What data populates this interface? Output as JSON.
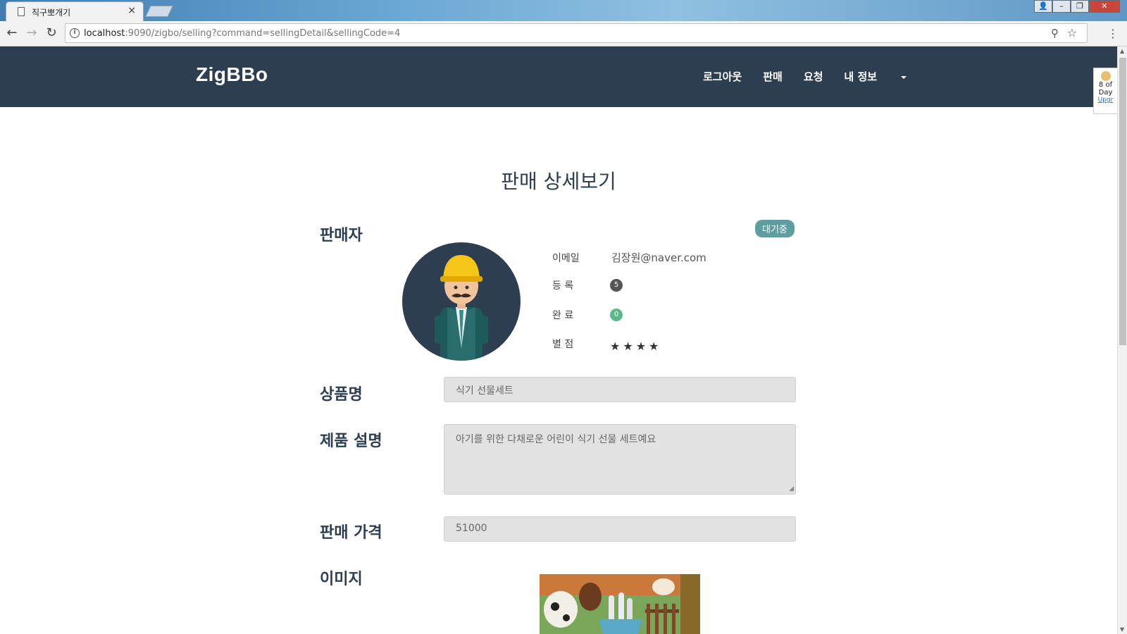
{
  "browser": {
    "tab_title": "직구뽀개기",
    "tab_close": "×",
    "url_host": "localhost",
    "url_rest": ":9090/zigbo/selling?command=sellingDetail&sellingCode=4",
    "extension": {
      "line1": "8 of",
      "line2": "Day",
      "link": "Upgr"
    }
  },
  "navbar": {
    "brand": "ZigBBo",
    "links": [
      "로그아웃",
      "판매",
      "요청",
      "내 정보"
    ]
  },
  "page": {
    "title": "판매 상세보기",
    "status_badge": "대기중",
    "labels": {
      "seller": "판매자",
      "product_name": "상품명",
      "description": "제품 설명",
      "price": "판매 가격",
      "image": "이미지"
    },
    "seller": {
      "email_label": "이메일",
      "email": "김장원@naver.com",
      "registered_label": "등 록",
      "registered": "5",
      "completed_label": "완 료",
      "completed": "0",
      "rating_label": "별 점",
      "rating": "★★★★"
    },
    "fields": {
      "product_name": "식기 선물세트",
      "description": "아기를 위한 다채로운 어린이 식기 선물 세트예요",
      "price": "51000"
    }
  },
  "colors": {
    "navbar": "#2c3e50",
    "badge_waiting": "#5f9ea0",
    "badge_completed": "#5cb88a"
  }
}
